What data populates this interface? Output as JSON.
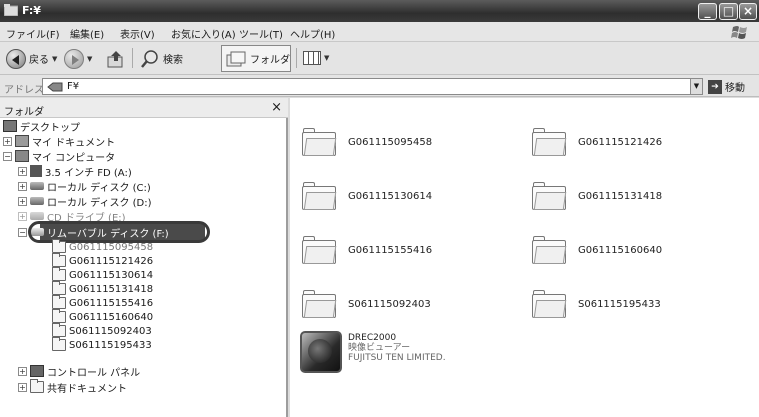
{
  "window": {
    "title": "F:¥"
  },
  "menu": [
    "ファイル(F)",
    "編集(E)",
    "表示(V)",
    "お気に入り(A)",
    "ツール(T)",
    "ヘルプ(H)"
  ],
  "toolbar": {
    "back_label": "戻る",
    "search_label": "検索",
    "folders_label": "フォルダ"
  },
  "address": {
    "label": "アドレス(D)",
    "value": "F¥",
    "go_label": "移動"
  },
  "folder_pane": {
    "title": "フォルダ",
    "close_glyph": "×",
    "tree": {
      "desktop": "デスクトップ",
      "my_documents": "マイ ドキュメント",
      "my_computer": "マイ コンピュータ",
      "floppy": "3.5 インチ FD (A:)",
      "local_c": "ローカル ディスク (C:)",
      "local_d": "ローカル ディスク (D:)",
      "cd_e": "CD ドライブ (E:)",
      "removable_f": "リムーバブル ディスク (F:)",
      "subfolders": [
        "G061115095458",
        "G061115121426",
        "G061115130614",
        "G061115131418",
        "G061115155416",
        "G061115160640",
        "S061115092403",
        "S061115195433"
      ],
      "control_panel": "コントロール パネル",
      "shared": "共有ドキュメント"
    }
  },
  "content": {
    "folders": [
      "G061115095458",
      "G061115121426",
      "G061115130614",
      "G061115131418",
      "G061115155416",
      "G061115160640",
      "S061115092403",
      "S061115195433"
    ],
    "app": {
      "name": "DREC2000",
      "desc": "映像ビューアー",
      "company": "FUJITSU TEN LIMITED."
    }
  }
}
